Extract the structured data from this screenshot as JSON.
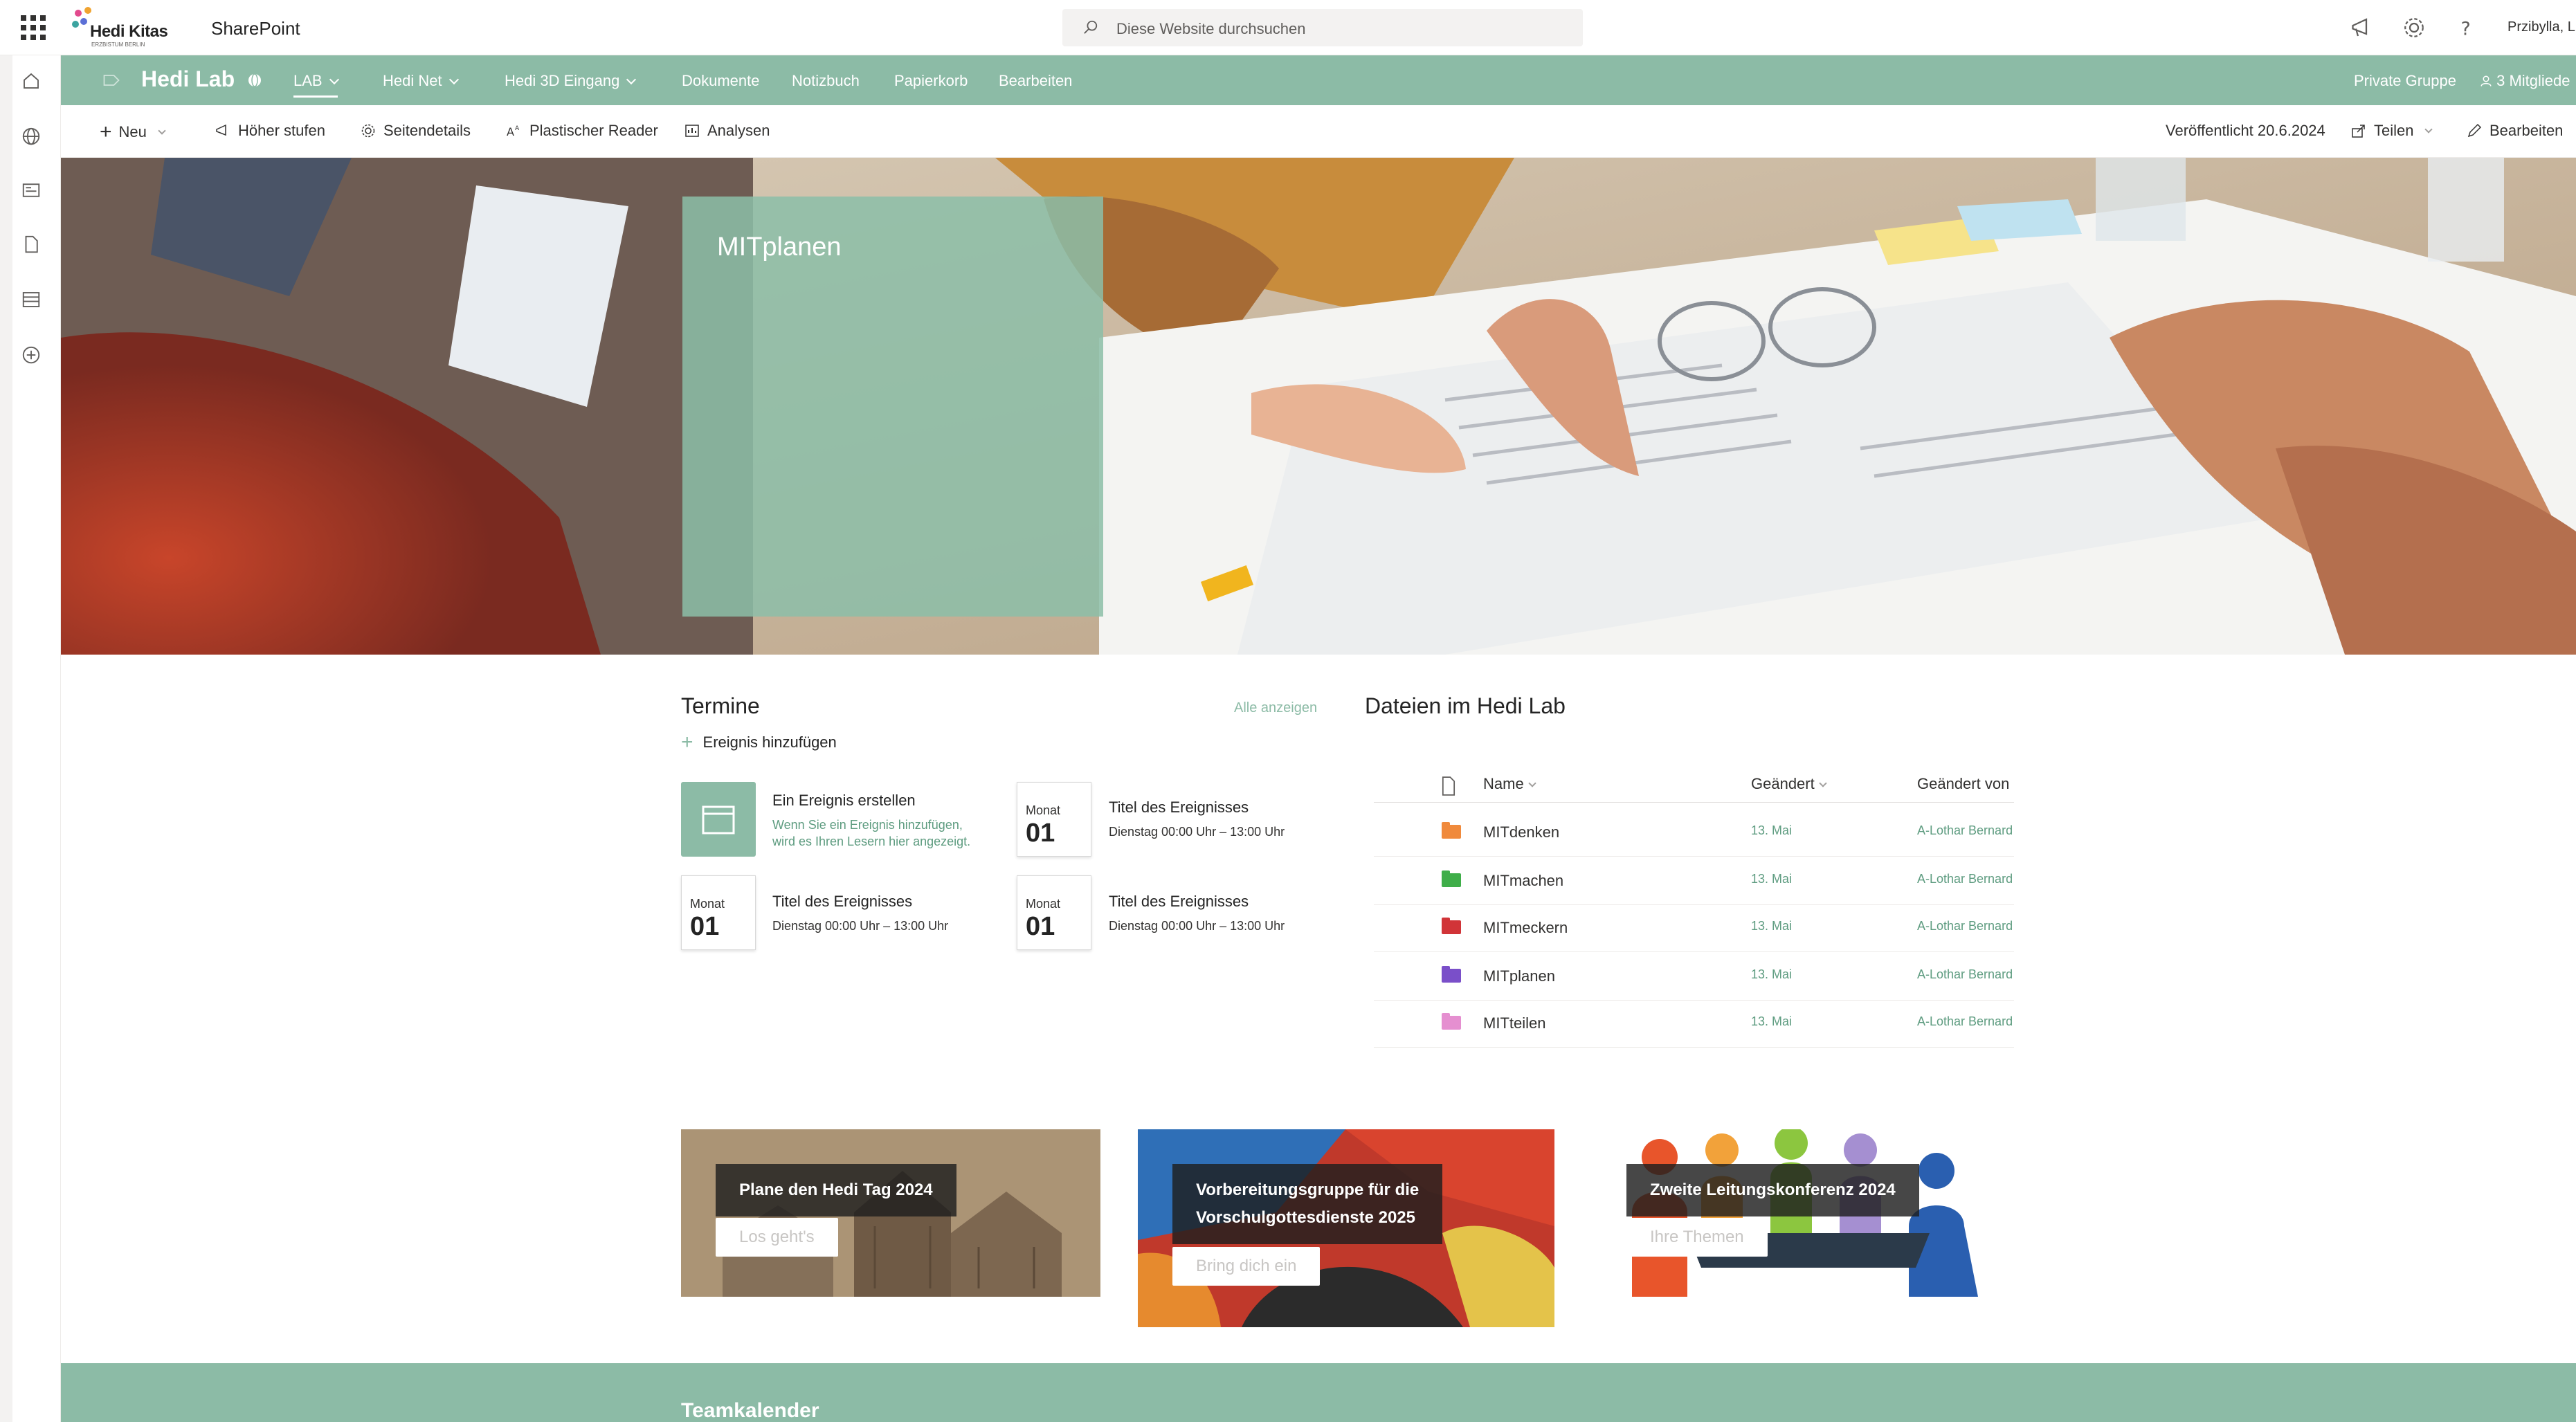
{
  "suite": {
    "org_name": "Hedi Kitas",
    "org_sub": "ERZBISTUM BERLIN",
    "app_name": "SharePoint",
    "search_placeholder": "Diese Website durchsuchen",
    "user": "Przibylla, L"
  },
  "site": {
    "title": "Hedi Lab",
    "nav": [
      {
        "label": "LAB"
      },
      {
        "label": "Hedi Net"
      },
      {
        "label": "Hedi 3D Eingang"
      },
      {
        "label": "Dokumente"
      },
      {
        "label": "Notizbuch"
      },
      {
        "label": "Papierkorb"
      },
      {
        "label": "Bearbeiten"
      }
    ],
    "group_label": "Private Gruppe",
    "members_label": "3 Mitgliede"
  },
  "commands": {
    "new": "Neu",
    "promote": "Höher stufen",
    "page_details": "Seitendetails",
    "immersive_reader": "Plastischer Reader",
    "analytics": "Analysen",
    "published": "Veröffentlicht 20.6.2024",
    "share": "Teilen",
    "edit": "Bearbeiten"
  },
  "hero": {
    "title": "MITplanen"
  },
  "events": {
    "title": "Termine",
    "see_all": "Alle anzeigen",
    "add_event": "Ereignis hinzufügen",
    "create_title": "Ein Ereignis erstellen",
    "create_desc_1": "Wenn Sie ein Ereignis hinzufügen,",
    "create_desc_2": "wird es Ihren Lesern hier angezeigt.",
    "items": [
      {
        "month": "Monat",
        "day": "01",
        "title": "Titel des Ereignisses",
        "time": "Dienstag 00:00 Uhr – 13:00 Uhr"
      },
      {
        "month": "Monat",
        "day": "01",
        "title": "Titel des Ereignisses",
        "time": "Dienstag 00:00 Uhr – 13:00 Uhr"
      },
      {
        "month": "Monat",
        "day": "01",
        "title": "Titel des Ereignisses",
        "time": "Dienstag 00:00 Uhr – 13:00 Uhr"
      }
    ]
  },
  "files": {
    "title": "Dateien im Hedi Lab",
    "col_name": "Name",
    "col_modified": "Geändert",
    "col_modified_by": "Geändert von",
    "rows": [
      {
        "name": "MITdenken",
        "modified": "13. Mai",
        "by": "A-Lothar Bernard",
        "color": "#f08a3c"
      },
      {
        "name": "MITmachen",
        "modified": "13. Mai",
        "by": "A-Lothar Bernard",
        "color": "#3fae49"
      },
      {
        "name": "MITmeckern",
        "modified": "13. Mai",
        "by": "A-Lothar Bernard",
        "color": "#d13438"
      },
      {
        "name": "MITplanen",
        "modified": "13. Mai",
        "by": "A-Lothar Bernard",
        "color": "#7a4fc9"
      },
      {
        "name": "MITteilen",
        "modified": "13. Mai",
        "by": "A-Lothar Bernard",
        "color": "#e58fd0"
      }
    ]
  },
  "cards": [
    {
      "label": "Plane den Hedi Tag 2024",
      "button": "Los geht's"
    },
    {
      "label_1": "Vorbereitungsgruppe für die",
      "label_2": "Vorschulgottesdienste 2025",
      "button": "Bring dich ein"
    },
    {
      "label": "Zweite Leitungskonferenz 2024",
      "button": "Ihre Themen"
    }
  ],
  "footer": {
    "title": "Teamkalender"
  },
  "colors": {
    "accent": "#8cbba6",
    "link": "#5e9c80"
  }
}
